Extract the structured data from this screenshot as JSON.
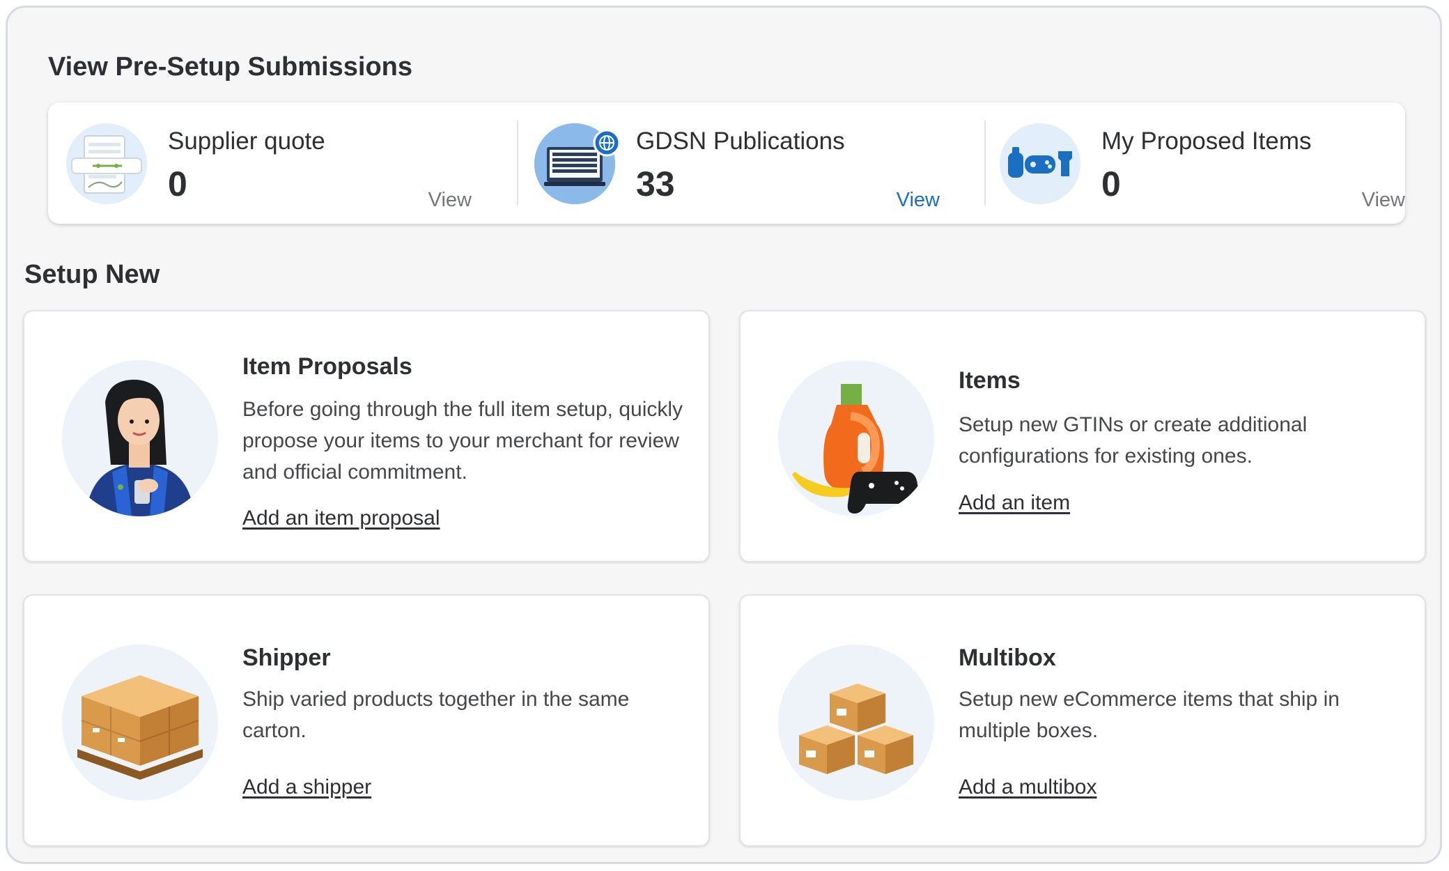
{
  "pre_setup": {
    "title": "View Pre-Setup Submissions",
    "stats": [
      {
        "label": "Supplier quote",
        "value": "0",
        "view_label": "View",
        "icon": "supplier-quote-icon"
      },
      {
        "label": "GDSN Publications",
        "value": "33",
        "view_label": "View",
        "icon": "gdsn-publications-icon"
      },
      {
        "label": "My Proposed Items",
        "value": "0",
        "view_label": "View",
        "icon": "proposed-items-icon"
      }
    ]
  },
  "setup_new": {
    "title": "Setup New",
    "cards": [
      {
        "title": "Item Proposals",
        "description": "Before going through the full item setup, quickly propose your items to your merchant for review and official commitment.",
        "link": "Add an item proposal",
        "icon": "associate-with-phone-illustration"
      },
      {
        "title": "Items",
        "description": "Setup new GTINs or create additional configurations for existing ones.",
        "link": "Add an item",
        "icon": "detergent-banana-controller-illustration"
      },
      {
        "title": "Shipper",
        "description": "Ship varied products together in the same carton.",
        "link": "Add a shipper",
        "icon": "pallet-boxes-illustration"
      },
      {
        "title": "Multibox",
        "description": "Setup new eCommerce items that ship in multiple boxes.",
        "link": "Add a multibox",
        "icon": "multiple-boxes-illustration"
      }
    ]
  },
  "colors": {
    "link_active": "#1a6fc2",
    "text": "#2e2f32",
    "muted": "#74767c",
    "panel_bg": "#f6f6f7",
    "card_bg": "#ffffff"
  }
}
